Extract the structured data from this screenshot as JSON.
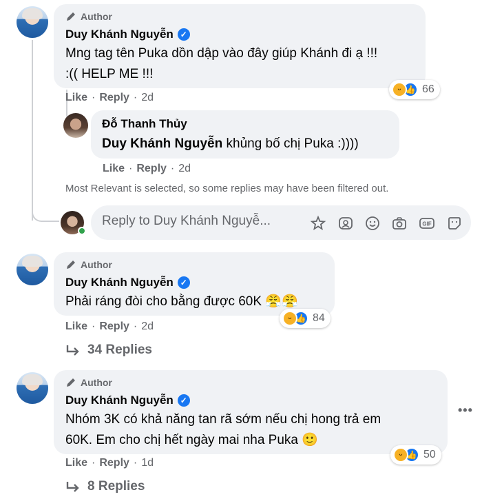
{
  "comments": [
    {
      "author_tag": "Author",
      "name": "Duy Khánh Nguyễn",
      "text_line1": "Mng tag tên Puka dồn dập vào đây giúp Khánh đi ạ !!!",
      "text_line2": ":(( HELP ME !!!",
      "like": "Like",
      "reply": "Reply",
      "time": "2d",
      "reaction_count": "66"
    },
    {
      "author_tag": "Author",
      "name": "Duy Khánh Nguyễn",
      "text_line1": "Phải ráng đòi cho bằng được 60K 😤😤",
      "like": "Like",
      "reply": "Reply",
      "time": "2d",
      "reaction_count": "84",
      "replies_label": "34 Replies"
    },
    {
      "author_tag": "Author",
      "name": "Duy Khánh Nguyễn",
      "text_line1": "Nhóm 3K có khả năng tan rã sớm nếu chị hong trả em",
      "text_line2": "60K. Em cho chị hết ngày mai nha Puka 🙂",
      "like": "Like",
      "reply": "Reply",
      "time": "1d",
      "reaction_count": "50",
      "replies_label": "8 Replies"
    }
  ],
  "nested_reply": {
    "name": "Đỗ Thanh Thủy",
    "mention": "Duy Khánh Nguyễn",
    "text": " khủng bố chị Puka :))))",
    "like": "Like",
    "reply": "Reply",
    "time": "2d"
  },
  "filter_notice": "Most Relevant is selected, so some replies may have been filtered out.",
  "reply_input": {
    "placeholder": "Reply to Duy Khánh Nguyễ..."
  },
  "separator": "·",
  "more_label": "•••",
  "icons": {
    "author_badge": "pencil-icon",
    "verified": "verified-badge-icon",
    "sticker": "sticker-icon",
    "avatar_frame": "avatar-frame-icon",
    "emoji": "emoji-icon",
    "camera": "camera-icon",
    "gif": "gif-icon",
    "sticker2": "sticker-face-icon"
  },
  "colors": {
    "bubble": "#f0f2f5",
    "secondary_text": "#65676b",
    "verified": "#1877f2",
    "online": "#31a24c"
  }
}
